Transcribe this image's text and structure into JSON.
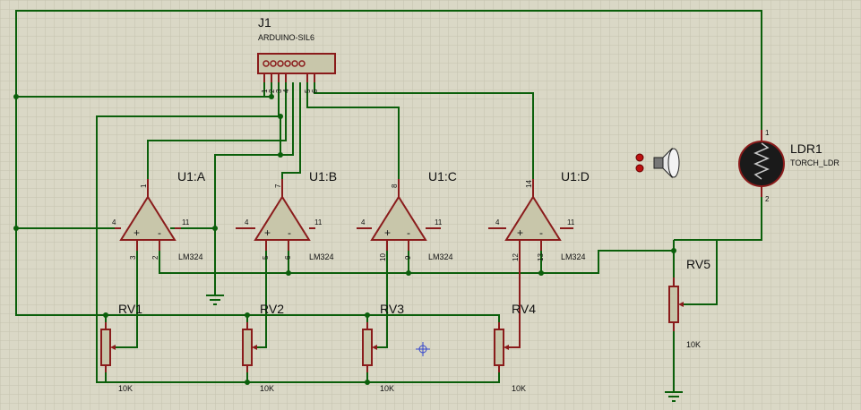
{
  "j1": {
    "ref": "J1",
    "value": "ARDUINO-SIL6",
    "pins": [
      "1",
      "2",
      "3",
      "4",
      "5",
      "6"
    ]
  },
  "opamps": [
    {
      "ref": "U1:A",
      "value": "LM324",
      "out": "1",
      "vcc": "4",
      "gnd": "11",
      "plus": "3",
      "minus": "2"
    },
    {
      "ref": "U1:B",
      "value": "LM324",
      "out": "7",
      "vcc": "4",
      "gnd": "11",
      "plus": "5",
      "minus": "6"
    },
    {
      "ref": "U1:C",
      "value": "LM324",
      "out": "8",
      "vcc": "4",
      "gnd": "11",
      "plus": "10",
      "minus": "9"
    },
    {
      "ref": "U1:D",
      "value": "LM324",
      "out": "14",
      "vcc": "4",
      "gnd": "11",
      "plus": "12",
      "minus": "13"
    }
  ],
  "pots": [
    {
      "ref": "RV1",
      "value": "10K"
    },
    {
      "ref": "RV2",
      "value": "10K"
    },
    {
      "ref": "RV3",
      "value": "10K"
    },
    {
      "ref": "RV4",
      "value": "10K"
    },
    {
      "ref": "RV5",
      "value": "10K"
    }
  ],
  "ldr": {
    "ref": "LDR1",
    "value": "TORCH_LDR",
    "pin1": "1",
    "pin2": "2"
  },
  "colors": {
    "background": "#dad8c6",
    "grid": "#c4c2af",
    "wire": "#0b5f0b",
    "component": "#8a1b1b",
    "component_fill": "#c8c6aa"
  }
}
